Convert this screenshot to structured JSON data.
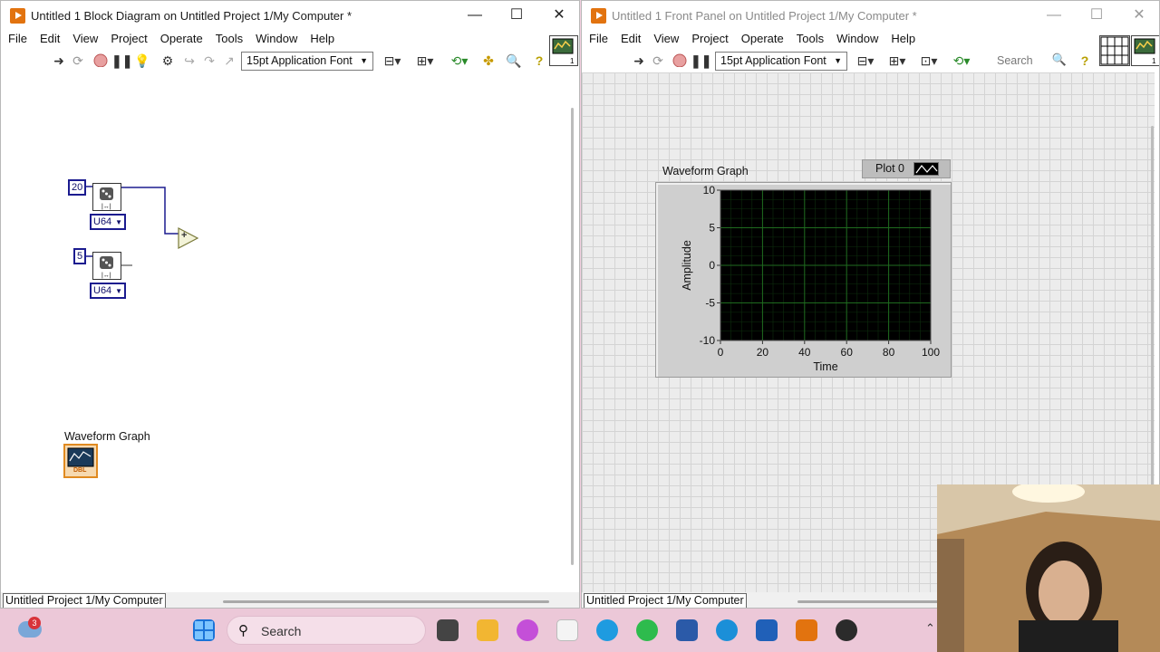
{
  "block_diagram": {
    "title": "Untitled 1 Block Diagram on Untitled Project 1/My Computer *",
    "menu": [
      "File",
      "Edit",
      "View",
      "Project",
      "Operate",
      "Tools",
      "Window",
      "Help"
    ],
    "font_select": "15pt Application Font",
    "nodes": {
      "const_a": "20",
      "const_b": "5",
      "type_a": "U64",
      "type_b": "U64",
      "add_symbol": "+",
      "graph_terminal_label": "Waveform Graph",
      "graph_terminal_tag": "DBL"
    },
    "status": "Untitled Project 1/My Computer"
  },
  "front_panel": {
    "title": "Untitled 1 Front Panel on Untitled Project 1/My Computer *",
    "menu": [
      "File",
      "Edit",
      "View",
      "Project",
      "Operate",
      "Tools",
      "Window",
      "Help"
    ],
    "font_select": "15pt Application Font",
    "search_placeholder": "Search",
    "graph_label": "Waveform Graph",
    "plot_legend": "Plot 0",
    "status": "Untitled Project 1/My Computer"
  },
  "chart_data": {
    "type": "line",
    "title": "",
    "xlabel": "Time",
    "ylabel": "Amplitude",
    "xlim": [
      0,
      100
    ],
    "ylim": [
      -10,
      10
    ],
    "x_ticks": [
      "0",
      "20",
      "40",
      "60",
      "80",
      "100"
    ],
    "y_ticks": [
      "10",
      "5",
      "0",
      "-5",
      "-10"
    ],
    "series": [
      {
        "name": "Plot 0",
        "values": []
      }
    ],
    "grid": true,
    "background": "#000000",
    "grid_color": "#1f6b1f"
  },
  "taskbar": {
    "search_label": "Search",
    "weather_badge": "3"
  },
  "colors": {
    "labview_orange": "#e2730f",
    "wire_blue": "#1b1b8f",
    "taskbar_bg": "#ecc8d8"
  },
  "icons": [
    "app-icon",
    "minimize-icon",
    "maximize-icon",
    "close-icon",
    "run-arrow-icon",
    "abort-icon",
    "pause-icon",
    "highlight-bulb-icon",
    "align-icon",
    "distribute-icon",
    "resize-icon",
    "reorder-icon",
    "search-icon",
    "help-icon",
    "windows-start-icon",
    "edge-icon",
    "whatsapp-icon",
    "word-icon"
  ]
}
